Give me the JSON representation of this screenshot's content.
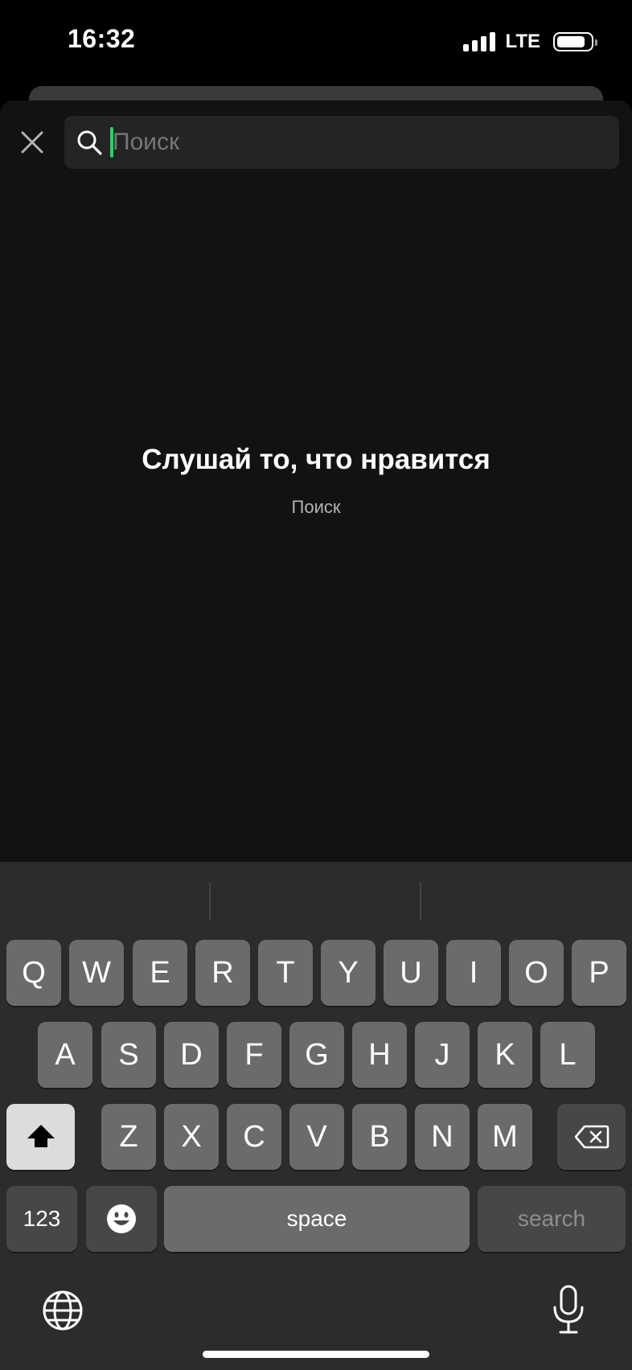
{
  "status": {
    "time": "16:32",
    "network": "LTE"
  },
  "search": {
    "placeholder": "Поиск",
    "value": ""
  },
  "empty_state": {
    "title": "Слушай то, что нравится",
    "subtitle": "Поиск"
  },
  "keyboard": {
    "row1": [
      "Q",
      "W",
      "E",
      "R",
      "T",
      "Y",
      "U",
      "I",
      "O",
      "P"
    ],
    "row2": [
      "A",
      "S",
      "D",
      "F",
      "G",
      "H",
      "J",
      "K",
      "L"
    ],
    "row3": [
      "Z",
      "X",
      "C",
      "V",
      "B",
      "N",
      "M"
    ],
    "numbers_label": "123",
    "space_label": "space",
    "search_label": "search"
  },
  "icons": {
    "close": "close-icon",
    "search": "search-icon",
    "shift": "shift-icon",
    "delete": "backspace-icon",
    "emoji": "emoji-icon",
    "globe": "globe-icon",
    "mic": "microphone-icon",
    "signal": "signal-icon",
    "battery": "battery-icon"
  },
  "colors": {
    "accent": "#1ed760",
    "background": "#121212",
    "search_bar": "#242424",
    "keyboard": "#2c2c2c"
  }
}
